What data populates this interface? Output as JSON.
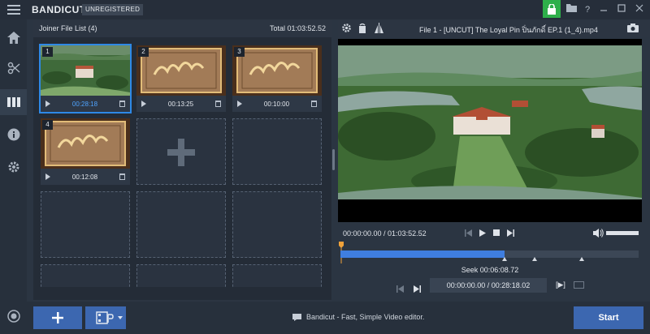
{
  "app": {
    "brand": "BANDICUT",
    "registration_badge": "UNREGISTERED"
  },
  "titlebar": {
    "icons": [
      "lock-icon",
      "folder-icon",
      "help-icon",
      "minimize-icon",
      "maximize-icon",
      "close-icon"
    ],
    "lock_color": "#2eaf4a"
  },
  "sidebar": {
    "items": [
      {
        "icon": "home-icon"
      },
      {
        "icon": "cut-icon"
      },
      {
        "icon": "joiner-icon",
        "active": true
      },
      {
        "icon": "info-icon"
      },
      {
        "icon": "settings-icon"
      }
    ],
    "bottom_icon": "record-icon"
  },
  "joiner": {
    "title": "Joiner File List (4)",
    "total": "Total 01:03:52.52",
    "clips": [
      {
        "num": "1",
        "duration": "00:28:18",
        "thumb": "aerial-palace-icon",
        "selected": true
      },
      {
        "num": "2",
        "duration": "00:13:25",
        "thumb": "title-card-icon",
        "selected": false
      },
      {
        "num": "3",
        "duration": "00:10:00",
        "thumb": "title-card-icon",
        "selected": false
      },
      {
        "num": "4",
        "duration": "00:12:08",
        "thumb": "title-card-icon",
        "selected": false
      }
    ],
    "empty_slots": 8,
    "footer_icons": [
      "list-delete-icon",
      "chevron-left-icon",
      "chevron-right-icon"
    ]
  },
  "player": {
    "header_icons": [
      "settings-icon",
      "rotate-icon",
      "flip-icon",
      "camera-icon"
    ],
    "filename": "File 1 - [UNCUT] The Loyal Pin ปิ่นภักดิ์ EP.1 (1_4).mp4",
    "time_readout": "00:00:00.00 / 01:03:52.52",
    "progress": 0.55,
    "markers": [
      0.55,
      0.65,
      0.81
    ],
    "seek_label": "Seek 00:06:08.72",
    "range": "00:00:00.00 / 00:28:18.02"
  },
  "bottom": {
    "add_icon": "plus-icon",
    "mode_icon": "film-mode-icon",
    "status_text": "Bandicut - Fast, Simple Video editor.",
    "start_label": "Start",
    "accent": "#3c67b0"
  }
}
